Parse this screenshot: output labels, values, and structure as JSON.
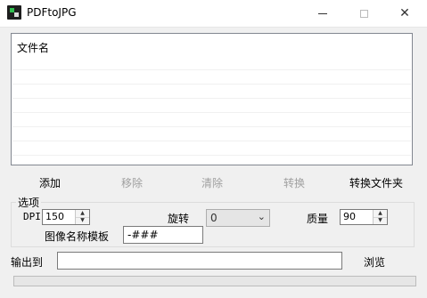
{
  "window": {
    "title": "PDFtoJPG",
    "minimize_glyph": "—",
    "maximize_glyph": "☐",
    "close_glyph": "✕"
  },
  "file_list": {
    "header": "文件名",
    "rows": []
  },
  "toolbar": {
    "add_label": "添加",
    "remove_label": "移除",
    "clear_label": "清除",
    "convert_label": "转换",
    "convert_folder_label": "转换文件夹"
  },
  "options": {
    "group_title": "选项",
    "dpi_label": "DPI",
    "dpi_value": "150",
    "rotate_label": "旋转",
    "rotate_value": "0",
    "quality_label": "质量",
    "quality_value": "90",
    "template_label": "图像名称模板",
    "template_value": "-###"
  },
  "output": {
    "label": "输出到",
    "path_value": "",
    "browse_label": "浏览"
  },
  "progress": {
    "value": 0
  },
  "icons": {
    "app": "app-icon",
    "spin_up": "▲",
    "spin_down": "▼",
    "dropdown": "⌄"
  }
}
